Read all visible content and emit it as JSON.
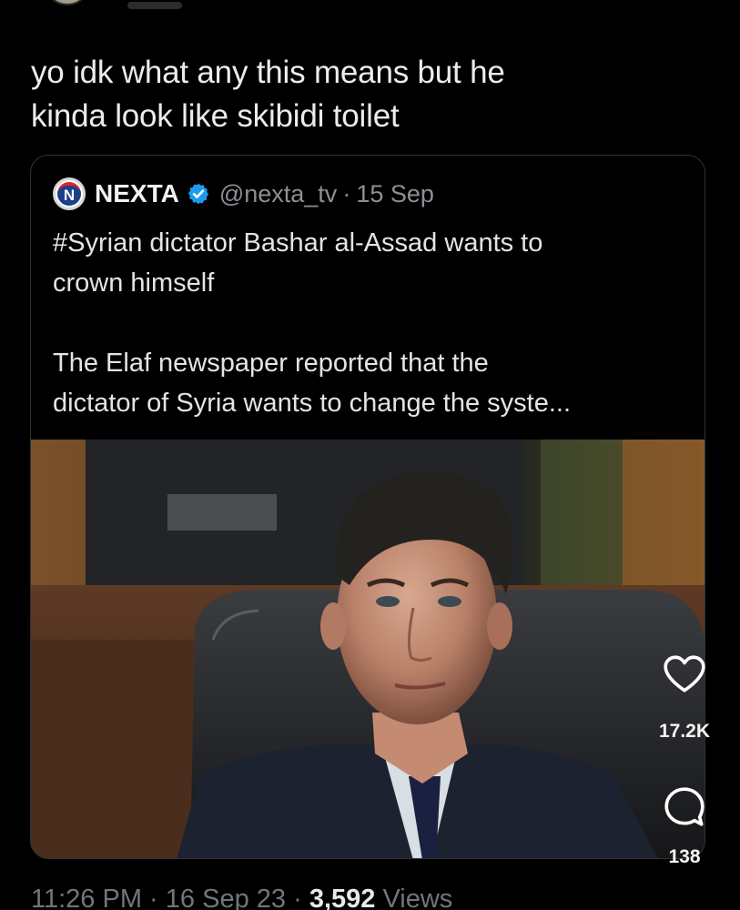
{
  "post": {
    "text_line1": "yo idk what any this means but he",
    "text_line2": "kinda look like skibidi toilet"
  },
  "quote": {
    "name": "NEXTA",
    "handle": "@nexta_tv",
    "separator": "·",
    "date": "15 Sep",
    "body_line1": "#Syrian dictator Bashar al-Assad wants to",
    "body_line2": "crown himself",
    "body_line3": "The Elaf newspaper reported that the",
    "body_line4": "dictator of Syria wants to change the syste...",
    "logo_letter": "N",
    "verified_color": "#1d9bf0"
  },
  "footer": {
    "time": "11:26 PM",
    "separator": "·",
    "date": "16 Sep 23",
    "views_count": "3,592",
    "views_label": "Views"
  },
  "actions": {
    "like_icon": "heart-icon",
    "like_count": "17.2K",
    "reply_icon": "comment-bubble-icon",
    "reply_count": "138"
  }
}
